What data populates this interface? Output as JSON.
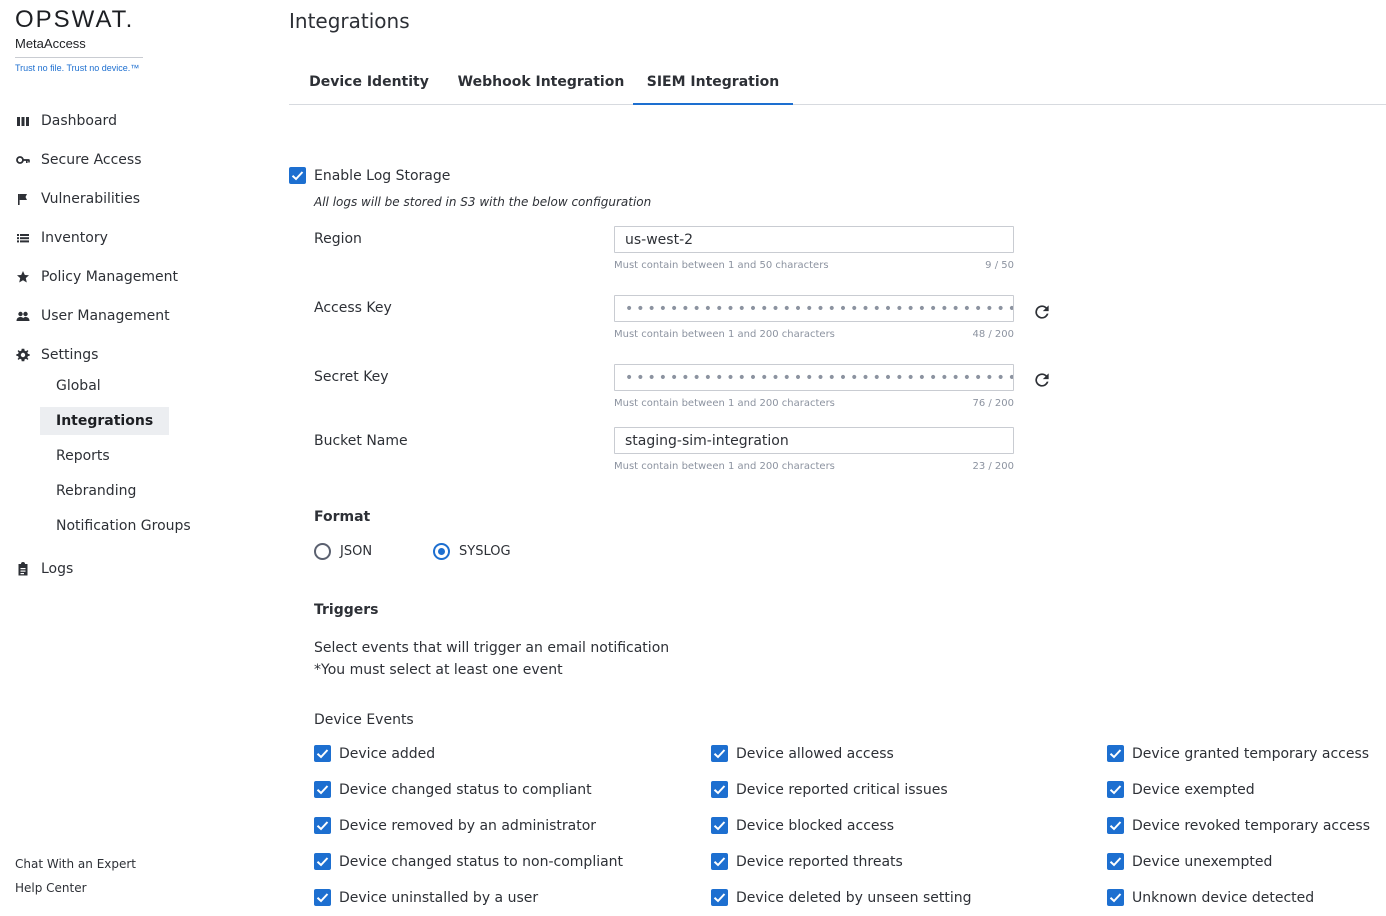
{
  "brand": {
    "logo": "OPSWAT.",
    "product": "MetaAccess",
    "tagline": "Trust no file. Trust no device.™"
  },
  "sidebar": {
    "items": [
      {
        "label": "Dashboard",
        "icon": "dashboard-icon"
      },
      {
        "label": "Secure Access",
        "icon": "key-icon"
      },
      {
        "label": "Vulnerabilities",
        "icon": "flag-icon"
      },
      {
        "label": "Inventory",
        "icon": "list-icon"
      },
      {
        "label": "Policy Management",
        "icon": "star-icon"
      },
      {
        "label": "User Management",
        "icon": "users-icon"
      },
      {
        "label": "Settings",
        "icon": "gear-icon"
      }
    ],
    "settings_sub": [
      "Global",
      "Integrations",
      "Reports",
      "Rebranding",
      "Notification Groups"
    ],
    "logs": "Logs",
    "footer": [
      "Chat With an Expert",
      "Help Center"
    ]
  },
  "page": {
    "title": "Integrations",
    "tabs": [
      "Device Identity",
      "Webhook Integration",
      "SIEM Integration"
    ],
    "active_tab": "SIEM Integration"
  },
  "log_storage": {
    "enable_label": "Enable Log Storage",
    "enabled": true,
    "note": "All logs will be stored in S3 with the below configuration"
  },
  "fields": {
    "region": {
      "label": "Region",
      "value": "us-west-2",
      "hint": "Must contain between 1 and 50 characters",
      "count": "9 / 50"
    },
    "access_key": {
      "label": "Access Key",
      "value": "••••••••••••••••••••••••••••••••••••••••••••••••",
      "hint": "Must contain between 1 and 200 characters",
      "count": "48 / 200"
    },
    "secret_key": {
      "label": "Secret Key",
      "value": "••••••••••••••••••••••••••••••••••••••••••••••••••••••••••••••••••••••••••••",
      "hint": "Must contain between 1 and 200 characters",
      "count": "76 / 200"
    },
    "bucket": {
      "label": "Bucket Name",
      "value": "staging-sim-integration",
      "hint": "Must contain between 1 and 200 characters",
      "count": "23 / 200"
    }
  },
  "format": {
    "title": "Format",
    "options": [
      "JSON",
      "SYSLOG"
    ],
    "selected": "SYSLOG"
  },
  "triggers": {
    "title": "Triggers",
    "line1": "Select events that will trigger an email notification",
    "line2": "*You must select at least one event",
    "group": "Device Events",
    "events": [
      "Device added",
      "Device allowed access",
      "Device granted temporary access",
      "Device changed status to compliant",
      "Device reported critical issues",
      "Device exempted",
      "Device removed by an administrator",
      "Device blocked access",
      "Device revoked temporary access",
      "Device changed status to non-compliant",
      "Device reported threats",
      "Device unexempted",
      "Device uninstalled by a user",
      "Device deleted by unseen setting",
      "Unknown device detected"
    ]
  },
  "colors": {
    "accent": "#1d6fd0",
    "text": "#2d3036",
    "muted": "#8c93a0"
  }
}
